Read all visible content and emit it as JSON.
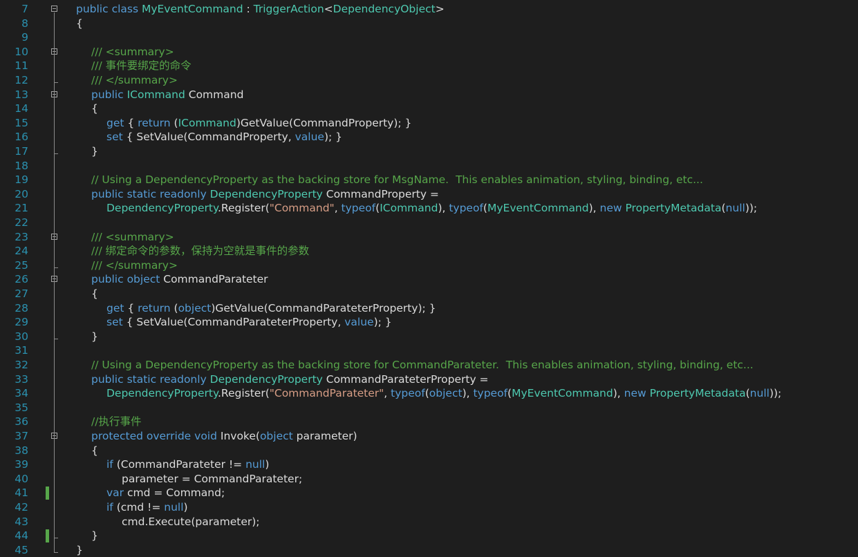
{
  "editor": {
    "lines": [
      {
        "num": "7",
        "indent": 0,
        "fold": true,
        "changed": false,
        "tokens": [
          [
            "kw",
            "public class "
          ],
          [
            "ty",
            "MyEventCommand"
          ],
          [
            "df",
            " : "
          ],
          [
            "ty",
            "TriggerAction"
          ],
          [
            "df",
            "<"
          ],
          [
            "ty",
            "DependencyObject"
          ],
          [
            "df",
            ">"
          ]
        ]
      },
      {
        "num": "8",
        "indent": 0,
        "fold": false,
        "changed": false,
        "tokens": [
          [
            "df",
            "{"
          ]
        ]
      },
      {
        "num": "9",
        "indent": 0,
        "fold": false,
        "changed": false,
        "tokens": []
      },
      {
        "num": "10",
        "indent": 1,
        "fold": true,
        "changed": false,
        "tokens": [
          [
            "cm",
            "/// <summary>"
          ]
        ]
      },
      {
        "num": "11",
        "indent": 1,
        "fold": false,
        "changed": false,
        "tokens": [
          [
            "cm",
            "/// 事件要绑定的命令"
          ]
        ]
      },
      {
        "num": "12",
        "indent": 1,
        "fold": false,
        "changed": false,
        "tokens": [
          [
            "cm",
            "/// </summary>"
          ]
        ]
      },
      {
        "num": "13",
        "indent": 1,
        "fold": true,
        "changed": false,
        "tokens": [
          [
            "kw",
            "public "
          ],
          [
            "ty",
            "ICommand"
          ],
          [
            "df",
            " Command"
          ]
        ]
      },
      {
        "num": "14",
        "indent": 1,
        "fold": false,
        "changed": false,
        "tokens": [
          [
            "df",
            "{"
          ]
        ]
      },
      {
        "num": "15",
        "indent": 2,
        "fold": false,
        "changed": false,
        "tokens": [
          [
            "kw",
            "get"
          ],
          [
            "df",
            " { "
          ],
          [
            "kw",
            "return"
          ],
          [
            "df",
            " ("
          ],
          [
            "ty",
            "ICommand"
          ],
          [
            "df",
            ")GetValue(CommandProperty); }"
          ]
        ]
      },
      {
        "num": "16",
        "indent": 2,
        "fold": false,
        "changed": false,
        "tokens": [
          [
            "kw",
            "set"
          ],
          [
            "df",
            " { SetValue(CommandProperty, "
          ],
          [
            "kw",
            "value"
          ],
          [
            "df",
            "); }"
          ]
        ]
      },
      {
        "num": "17",
        "indent": 1,
        "fold": false,
        "changed": false,
        "tokens": [
          [
            "df",
            "}"
          ]
        ]
      },
      {
        "num": "18",
        "indent": 0,
        "fold": false,
        "changed": false,
        "tokens": []
      },
      {
        "num": "19",
        "indent": 1,
        "fold": false,
        "changed": false,
        "tokens": [
          [
            "cm",
            "// Using a DependencyProperty as the backing store for MsgName.  This enables animation, styling, binding, etc..."
          ]
        ]
      },
      {
        "num": "20",
        "indent": 1,
        "fold": false,
        "changed": false,
        "tokens": [
          [
            "kw",
            "public static readonly "
          ],
          [
            "ty",
            "DependencyProperty"
          ],
          [
            "df",
            " CommandProperty ="
          ]
        ]
      },
      {
        "num": "21",
        "indent": 2,
        "fold": false,
        "changed": false,
        "tokens": [
          [
            "ty",
            "DependencyProperty"
          ],
          [
            "df",
            ".Register("
          ],
          [
            "st",
            "\"Command\""
          ],
          [
            "df",
            ", "
          ],
          [
            "kw",
            "typeof"
          ],
          [
            "df",
            "("
          ],
          [
            "ty",
            "ICommand"
          ],
          [
            "df",
            "), "
          ],
          [
            "kw",
            "typeof"
          ],
          [
            "df",
            "("
          ],
          [
            "ty",
            "MyEventCommand"
          ],
          [
            "df",
            "), "
          ],
          [
            "kw",
            "new "
          ],
          [
            "ty",
            "PropertyMetadata"
          ],
          [
            "df",
            "("
          ],
          [
            "kw",
            "null"
          ],
          [
            "df",
            "));"
          ]
        ]
      },
      {
        "num": "22",
        "indent": 0,
        "fold": false,
        "changed": false,
        "tokens": []
      },
      {
        "num": "23",
        "indent": 1,
        "fold": true,
        "changed": false,
        "tokens": [
          [
            "cm",
            "/// <summary>"
          ]
        ]
      },
      {
        "num": "24",
        "indent": 1,
        "fold": false,
        "changed": false,
        "tokens": [
          [
            "cm",
            "/// 绑定命令的参数，保持为空就是事件的参数"
          ]
        ]
      },
      {
        "num": "25",
        "indent": 1,
        "fold": false,
        "changed": false,
        "tokens": [
          [
            "cm",
            "/// </summary>"
          ]
        ]
      },
      {
        "num": "26",
        "indent": 1,
        "fold": true,
        "changed": false,
        "tokens": [
          [
            "kw",
            "public object"
          ],
          [
            "df",
            " CommandParateter"
          ]
        ]
      },
      {
        "num": "27",
        "indent": 1,
        "fold": false,
        "changed": false,
        "tokens": [
          [
            "df",
            "{"
          ]
        ]
      },
      {
        "num": "28",
        "indent": 2,
        "fold": false,
        "changed": false,
        "tokens": [
          [
            "kw",
            "get"
          ],
          [
            "df",
            " { "
          ],
          [
            "kw",
            "return"
          ],
          [
            "df",
            " ("
          ],
          [
            "kw",
            "object"
          ],
          [
            "df",
            ")GetValue(CommandParateterProperty); }"
          ]
        ]
      },
      {
        "num": "29",
        "indent": 2,
        "fold": false,
        "changed": false,
        "tokens": [
          [
            "kw",
            "set"
          ],
          [
            "df",
            " { SetValue(CommandParateterProperty, "
          ],
          [
            "kw",
            "value"
          ],
          [
            "df",
            "); }"
          ]
        ]
      },
      {
        "num": "30",
        "indent": 1,
        "fold": false,
        "changed": false,
        "tokens": [
          [
            "df",
            "}"
          ]
        ]
      },
      {
        "num": "31",
        "indent": 0,
        "fold": false,
        "changed": false,
        "tokens": []
      },
      {
        "num": "32",
        "indent": 1,
        "fold": false,
        "changed": false,
        "tokens": [
          [
            "cm",
            "// Using a DependencyProperty as the backing store for CommandParateter.  This enables animation, styling, binding, etc..."
          ]
        ]
      },
      {
        "num": "33",
        "indent": 1,
        "fold": false,
        "changed": false,
        "tokens": [
          [
            "kw",
            "public static readonly "
          ],
          [
            "ty",
            "DependencyProperty"
          ],
          [
            "df",
            " CommandParateterProperty ="
          ]
        ]
      },
      {
        "num": "34",
        "indent": 2,
        "fold": false,
        "changed": false,
        "tokens": [
          [
            "ty",
            "DependencyProperty"
          ],
          [
            "df",
            ".Register("
          ],
          [
            "st",
            "\"CommandParateter\""
          ],
          [
            "df",
            ", "
          ],
          [
            "kw",
            "typeof"
          ],
          [
            "df",
            "("
          ],
          [
            "kw",
            "object"
          ],
          [
            "df",
            "), "
          ],
          [
            "kw",
            "typeof"
          ],
          [
            "df",
            "("
          ],
          [
            "ty",
            "MyEventCommand"
          ],
          [
            "df",
            "), "
          ],
          [
            "kw",
            "new "
          ],
          [
            "ty",
            "PropertyMetadata"
          ],
          [
            "df",
            "("
          ],
          [
            "kw",
            "null"
          ],
          [
            "df",
            "));"
          ]
        ]
      },
      {
        "num": "35",
        "indent": 0,
        "fold": false,
        "changed": false,
        "tokens": []
      },
      {
        "num": "36",
        "indent": 1,
        "fold": false,
        "changed": false,
        "tokens": [
          [
            "cm",
            "//执行事件"
          ]
        ]
      },
      {
        "num": "37",
        "indent": 1,
        "fold": true,
        "changed": false,
        "tokens": [
          [
            "kw",
            "protected override void"
          ],
          [
            "df",
            " Invoke("
          ],
          [
            "kw",
            "object"
          ],
          [
            "df",
            " parameter)"
          ]
        ]
      },
      {
        "num": "38",
        "indent": 1,
        "fold": false,
        "changed": false,
        "tokens": [
          [
            "df",
            "{"
          ]
        ]
      },
      {
        "num": "39",
        "indent": 2,
        "fold": false,
        "changed": false,
        "tokens": [
          [
            "kw",
            "if"
          ],
          [
            "df",
            " (CommandParateter != "
          ],
          [
            "kw",
            "null"
          ],
          [
            "df",
            ")"
          ]
        ]
      },
      {
        "num": "40",
        "indent": 3,
        "fold": false,
        "changed": false,
        "tokens": [
          [
            "df",
            "parameter = CommandParateter;"
          ]
        ]
      },
      {
        "num": "41",
        "indent": 2,
        "fold": false,
        "changed": true,
        "tokens": [
          [
            "kw",
            "var"
          ],
          [
            "df",
            " cmd = Command;"
          ]
        ]
      },
      {
        "num": "42",
        "indent": 2,
        "fold": false,
        "changed": false,
        "tokens": [
          [
            "kw",
            "if"
          ],
          [
            "df",
            " (cmd != "
          ],
          [
            "kw",
            "null"
          ],
          [
            "df",
            ")"
          ]
        ]
      },
      {
        "num": "43",
        "indent": 3,
        "fold": false,
        "changed": false,
        "tokens": [
          [
            "df",
            "cmd.Execute(parameter);"
          ]
        ]
      },
      {
        "num": "44",
        "indent": 1,
        "fold": false,
        "changed": true,
        "tokens": [
          [
            "df",
            "}"
          ]
        ]
      },
      {
        "num": "45",
        "indent": 0,
        "fold": false,
        "changed": false,
        "tokens": [
          [
            "df",
            "}"
          ]
        ]
      }
    ],
    "colors": {
      "background": "#1e1e1e",
      "line_number": "#2b91af",
      "keyword": "#569cd6",
      "type": "#4ec9b0",
      "comment": "#57a64a",
      "string": "#d69d85",
      "default": "#dcdcdc",
      "change_marker": "#57a64a"
    }
  }
}
